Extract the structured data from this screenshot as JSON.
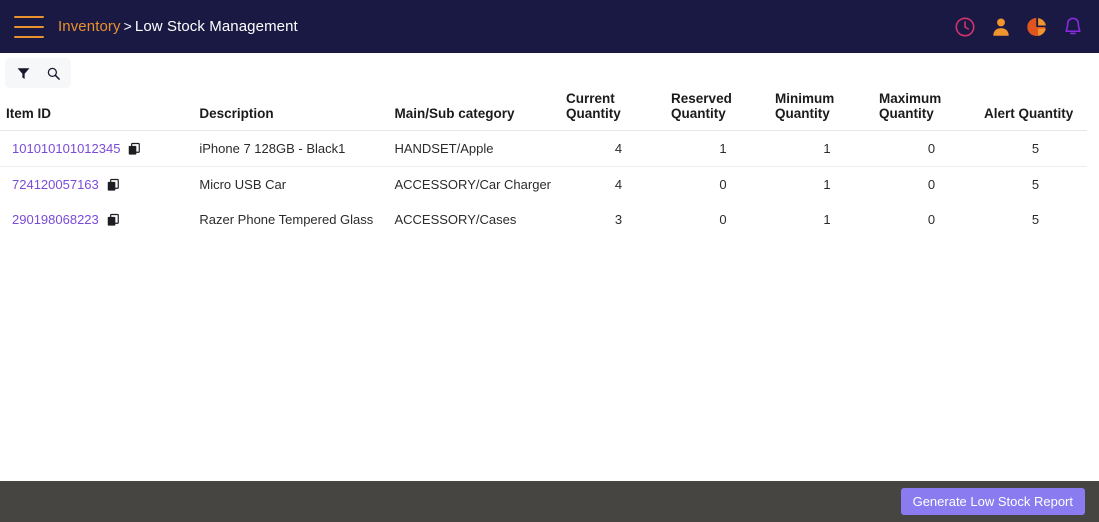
{
  "topbar": {
    "menu_icon": "hamburger-icon",
    "breadcrumb": {
      "parent": "Inventory",
      "separator": ">",
      "current": "Low Stock Management"
    },
    "icons": [
      {
        "name": "clock-icon",
        "color": "#d6336c"
      },
      {
        "name": "user-icon",
        "color": "#f0942e"
      },
      {
        "name": "pie-chart-icon",
        "color": "#f0942e"
      },
      {
        "name": "bell-icon",
        "color": "#8a2be2"
      }
    ],
    "background": "#191944",
    "accent": "#e8912d"
  },
  "toolbar": {
    "filter_icon": "filter-icon",
    "search_icon": "search-icon",
    "background": "#f6f7f9"
  },
  "table": {
    "columns": [
      "Item ID",
      "Description",
      "Main/Sub category",
      "Current Quantity",
      "Reserved Quantity",
      "Minimum Quantity",
      "Maximum Quantity",
      "Alert Quantity"
    ],
    "link_color": "#7b4bd8",
    "rows": [
      {
        "item_id": "101010101012345",
        "copy_icon": "copy-icon",
        "description": "iPhone 7 128GB - Black1",
        "category": "HANDSET/Apple",
        "current_quantity": "4",
        "reserved_quantity": "1",
        "minimum_quantity": "1",
        "maximum_quantity": "0",
        "alert_quantity": "5"
      },
      {
        "item_id": "724120057163",
        "copy_icon": "copy-icon",
        "description": "Micro USB Car",
        "category": "ACCESSORY/Car Charger",
        "current_quantity": "4",
        "reserved_quantity": "0",
        "minimum_quantity": "1",
        "maximum_quantity": "0",
        "alert_quantity": "5"
      },
      {
        "item_id": "290198068223",
        "copy_icon": "copy-icon",
        "description": "Razer Phone Tempered Glass",
        "category": "ACCESSORY/Cases",
        "current_quantity": "3",
        "reserved_quantity": "0",
        "minimum_quantity": "1",
        "maximum_quantity": "0",
        "alert_quantity": "5"
      }
    ]
  },
  "footer": {
    "generate_report_label": "Generate Low Stock Report",
    "background": "#464541",
    "button_color": "#8a7bf0"
  }
}
